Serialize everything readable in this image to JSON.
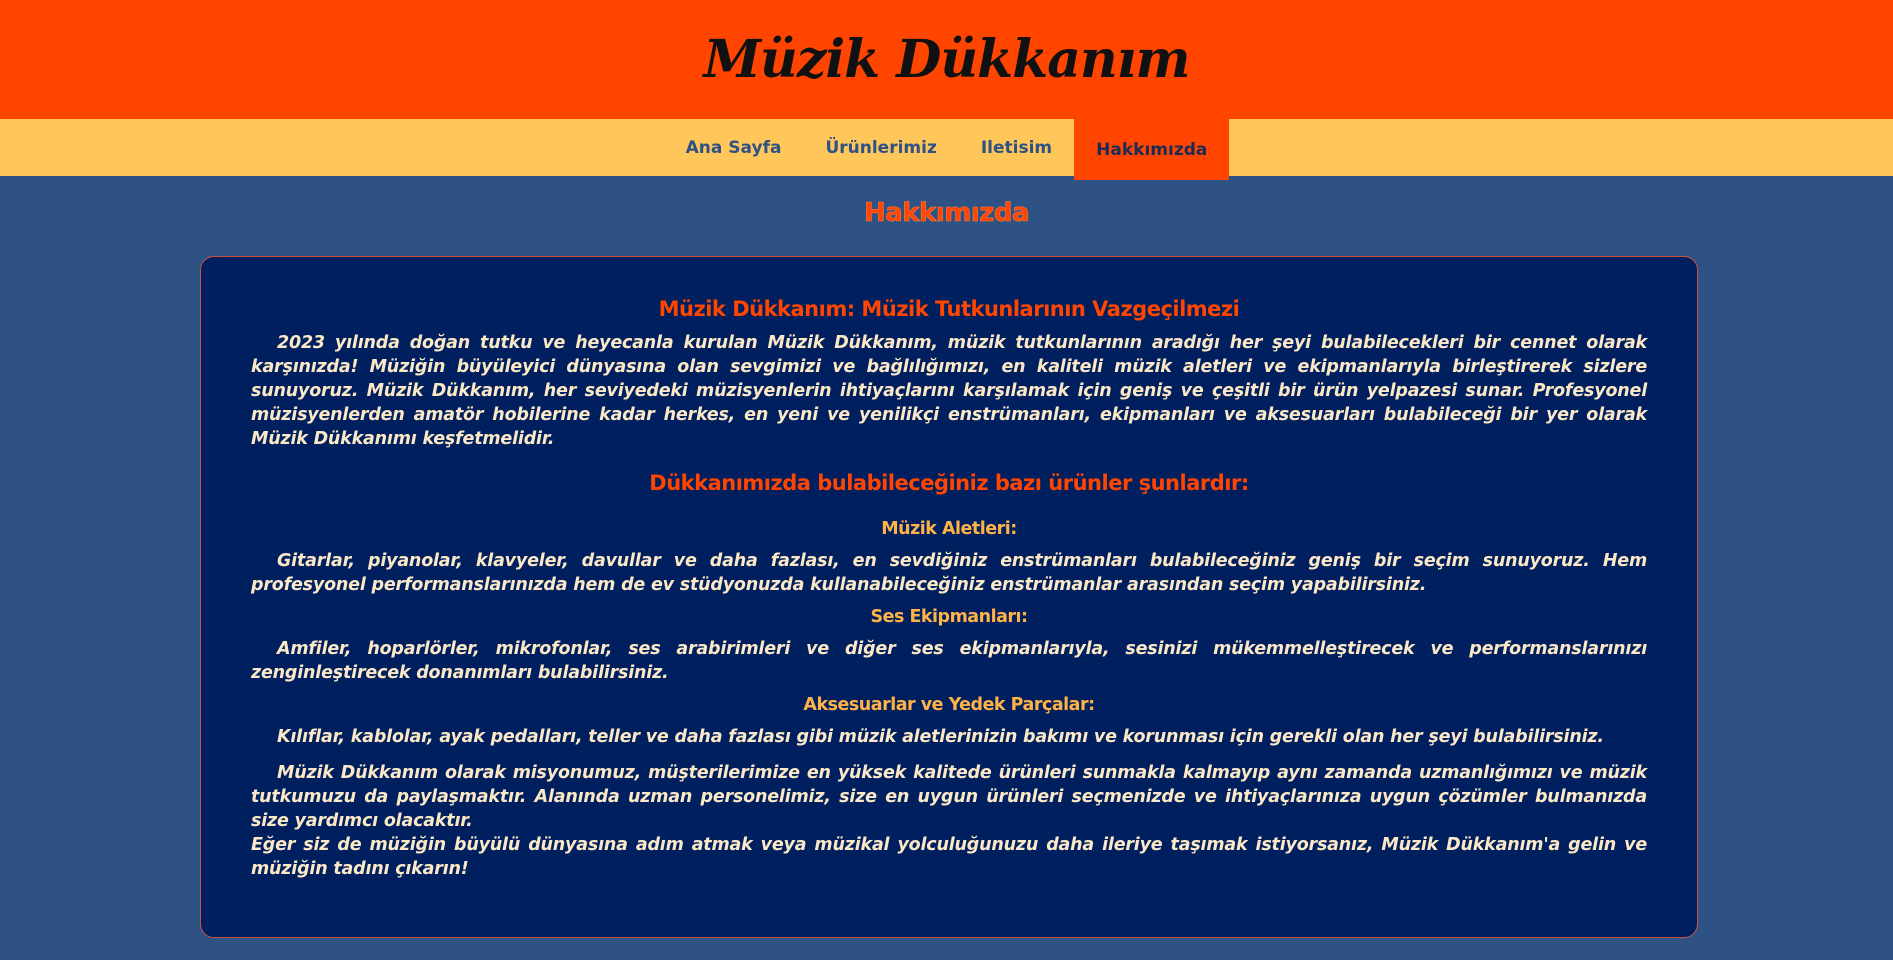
{
  "header": {
    "title": "Müzik Dükkanım"
  },
  "nav": {
    "items": [
      {
        "label": "Ana Sayfa"
      },
      {
        "label": "Ürünlerimiz"
      },
      {
        "label": "Iletisim"
      },
      {
        "label": "Hakkımızda"
      }
    ],
    "active": "Hakkımızda"
  },
  "main": {
    "heading": "Hakkımızda",
    "box_title": "Müzik Dükkanım: Müzik Tutkunlarının Vazgeçilmezi",
    "intro": "2023 yılında doğan tutku ve heyecanla kurulan Müzik Dükkanım, müzik tutkunlarının aradığı her şeyi bulabilecekleri bir cennet olarak karşınızda! Müziğin büyüleyici dünyasına olan sevgimizi ve bağlılığımızı, en kaliteli müzik aletleri ve ekipmanlarıyla birleştirerek sizlere sunuyoruz. Müzik Dükkanım, her seviyedeki müzisyenlerin ihtiyaçlarını karşılamak için geniş ve çeşitli bir ürün yelpazesi sunar. Profesyonel müzisyenlerden amatör hobilerine kadar herkes, en yeni ve yenilikçi enstrümanları, ekipmanları ve aksesuarları bulabileceği bir yer olarak Müzik Dükkanımı keşfetmelidir.",
    "products_title": "Dükkanımızda bulabileceğiniz bazı ürünler şunlardır:",
    "categories": [
      {
        "title": "Müzik Aletleri:",
        "text": "Gitarlar, piyanolar, klavyeler, davullar ve daha fazlası, en sevdiğiniz enstrümanları bulabileceğiniz geniş bir seçim sunuyoruz. Hem profesyonel performanslarınızda hem de ev stüdyonuzda kullanabileceğiniz enstrümanlar arasından seçim yapabilirsiniz."
      },
      {
        "title": "Ses Ekipmanları:",
        "text": "Amfiler, hoparlörler, mikrofonlar, ses arabirimleri ve diğer ses ekipmanlarıyla, sesinizi mükemmelleştirecek ve performanslarınızı zenginleştirecek donanımları bulabilirsiniz."
      },
      {
        "title": "Aksesuarlar ve Yedek Parçalar:",
        "text": "Kılıflar, kablolar, ayak pedalları, teller ve daha fazlası gibi müzik aletlerinizin bakımı ve korunması için gerekli olan her şeyi bulabilirsiniz."
      }
    ],
    "mission": "Müzik Dükkanım olarak misyonumuz, müşterilerimize en yüksek kalitede ürünleri sunmakla kalmayıp aynı zamanda uzmanlığımızı ve müzik tutkumuzu da paylaşmaktır. Alanında uzman personelimiz, size en uygun ürünleri seçmenizde ve ihtiyaçlarınıza uygun çözümler bulmanızda size yardımcı olacaktır.",
    "closing": "Eğer siz de müziğin büyülü dünyasına adım atmak veya müzikal yolculuğunuzu daha ileriye taşımak istiyorsanız, Müzik Dükkanım'a gelin ve müziğin tadını çıkarın!"
  },
  "colors": {
    "header_bg": "#ff4500",
    "nav_bg": "#ffc65a",
    "page_bg": "#2f5284",
    "box_bg": "#001f5f",
    "accent": "#ff4500",
    "subheading": "#ffb347",
    "text": "#fbe8c6"
  }
}
